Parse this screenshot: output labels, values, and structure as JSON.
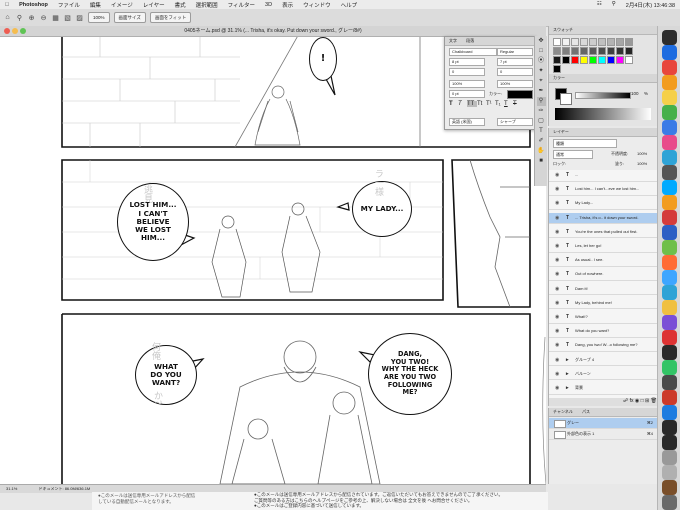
{
  "menubar": {
    "app": "Photoshop",
    "items": [
      "ファイル",
      "編集",
      "イメージ",
      "レイヤー",
      "書式",
      "選択範囲",
      "フィルター",
      "3D",
      "表示",
      "ウィンドウ",
      "ヘルプ"
    ],
    "clock": "2月4日(木)  13:46:38"
  },
  "options": {
    "zoom_btn": "100%",
    "fit_btn": "画面サイズ",
    "fill_btn": "画面をフィット"
  },
  "document": {
    "title": "0405ネーム.psd @ 31.1% (... Trisha,  it's okay.  Put down  your sword.,  グレー/8#)",
    "zoom": "31.1%",
    "doc_info": "ドキュメント: 86.0M/636.1M"
  },
  "character_panel": {
    "tab1": "文字",
    "tab2": "段落",
    "font": "Chalkboard",
    "style": "Regular",
    "size": "8 pt",
    "leading": "7 pt",
    "kerning": "0",
    "tracking": "0",
    "scale_v": "100%",
    "scale_h": "100%",
    "baseline": "0 pt",
    "color_label": "カラー:",
    "lang": "英語 (米国)",
    "aa": "シャープ",
    "format_buttons": [
      "T",
      "T",
      "TT",
      "Tt",
      "T¹",
      "T₁",
      "T",
      "T"
    ]
  },
  "swatches": {
    "tab": "スウォッチ",
    "color_tab": "カラー",
    "k_value": "100",
    "k_unit": "%",
    "colors": [
      "#ffffff",
      "#f2f2f2",
      "#e6e6e6",
      "#d9d9d9",
      "#cccccc",
      "#bfbfbf",
      "#b3b3b3",
      "#a6a6a6",
      "#999999",
      "#8c8c8c",
      "#808080",
      "#737373",
      "#666666",
      "#595959",
      "#4d4d4d",
      "#404040",
      "#333333",
      "#262626",
      "#1a1a1a",
      "#000000",
      "#ff0000",
      "#ffff00",
      "#00ff00",
      "#00ffff",
      "#0000ff",
      "#ff00ff",
      "#ffffff",
      "#000000"
    ]
  },
  "layers": {
    "tab": "レイヤー",
    "search": "種類",
    "blend": "通常",
    "opacity_label": "不透明度:",
    "opacity": "100%",
    "fill_label": "塗り:",
    "fill": "100%",
    "lock_label": "ロック:",
    "items": [
      {
        "type": "T",
        "name": "...",
        "sel": false
      },
      {
        "type": "T",
        "name": "Lost him... I can't...eve we lost him...",
        "sel": false
      },
      {
        "type": "T",
        "name": "My Lady...",
        "sel": false
      },
      {
        "type": "T",
        "name": "... Trisha, it's o.. it down your sword.",
        "sel": true
      },
      {
        "type": "T",
        "name": "You're the ones that pulled out first.",
        "sel": false
      },
      {
        "type": "T",
        "name": "Les, let her go!",
        "sel": false
      },
      {
        "type": "T",
        "name": "As usual.. I see.",
        "sel": false
      },
      {
        "type": "T",
        "name": "Out of nowhere.",
        "sel": false
      },
      {
        "type": "T",
        "name": "Dam it!",
        "sel": false
      },
      {
        "type": "T",
        "name": "My Lady, behind me!",
        "sel": false
      },
      {
        "type": "T",
        "name": "What!?",
        "sel": false
      },
      {
        "type": "T",
        "name": "What do you want?",
        "sel": false
      },
      {
        "type": "T",
        "name": "Dang, you two! W...o following me?",
        "sel": false
      },
      {
        "type": "▸",
        "name": "グループ 4",
        "sel": false
      },
      {
        "type": "▸",
        "name": "バルーン",
        "sel": false
      },
      {
        "type": "▸",
        "name": "背景",
        "sel": false
      }
    ]
  },
  "channels": {
    "tab1": "チャンネル",
    "tab2": "パス",
    "items": [
      {
        "name": "グレー",
        "key": "⌘2",
        "sel": true
      },
      {
        "name": "外部色の表示 1",
        "key": "⌘4",
        "sel": false
      }
    ]
  },
  "comic": {
    "bubble1": "!",
    "bubble2": "LOST HIM...\nI CAN'T\nBELIEVE\nWE LOST\nHIM...",
    "bubble3": "MY LADY...",
    "bubble4": "WHAT\nDO YOU\nWANT?",
    "bubble5": "DANG,\nYOU TWO!\nWHY THE HECK\nARE YOU TWO\nFOLLOWING\nME?",
    "jp1": "逃見",
    "jp2": "ラ一様",
    "jp3": "何俺",
    "jp4": "か?"
  },
  "mail": {
    "line1": "●このメールは送信専用メールアドレスから配信されています。ご返信いただいてもお答えできませんのでご了承ください。",
    "line2": "ご質問等のある方はこちらのヘルプページをご参考の上、解決しない場合は 全文を後 へお問合せください。",
    "line3": "●このメールはご登録内容に基づいて送信しています。",
    "left1": "●このメールは送信専用メールアドレスから配信",
    "left2": "している自動配信メールとなります。"
  },
  "dock": {
    "colors": [
      "#2d2d2d",
      "#1e6ce0",
      "#e8463c",
      "#f29c1f",
      "#f5d04a",
      "#46b04a",
      "#3b7be6",
      "#e84b8a",
      "#2fa3d6",
      "#555555",
      "#00aaff",
      "#f29c1f",
      "#d43b3b",
      "#2d5fc4",
      "#6fbf4a",
      "#ff6b35",
      "#3ea6ff",
      "#2fa3d6",
      "#f0c040",
      "#7a4fd6",
      "#d33",
      "#2a2a2a",
      "#33c466",
      "#4a4a4a",
      "#cc3a2a",
      "#1e7ce0",
      "#2a2a2a",
      "#2a2a2a",
      "#999999",
      "#b0b0b0",
      "#7a4f2a",
      "#6a6a6a"
    ]
  }
}
